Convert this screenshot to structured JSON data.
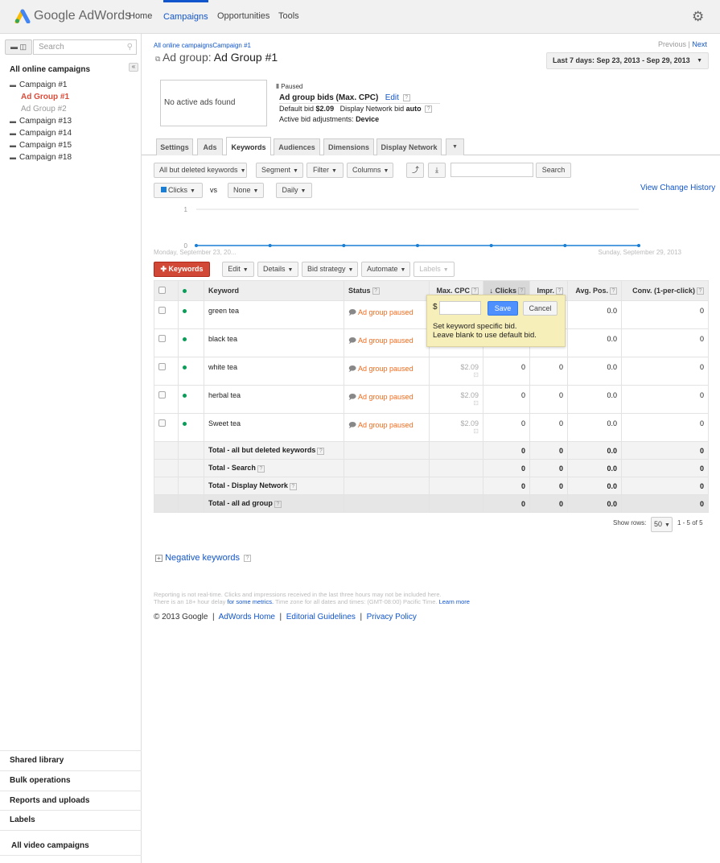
{
  "header": {
    "logo_google": "Google",
    "logo_product": "AdWords",
    "nav": [
      "Home",
      "Campaigns",
      "Opportunities",
      "Tools"
    ],
    "active_nav": "Campaigns"
  },
  "sidebar": {
    "search_placeholder": "Search",
    "title": "All online campaigns",
    "tree": [
      {
        "label": "Campaign #1",
        "level": 0
      },
      {
        "label": "Ad Group #1",
        "level": 1,
        "selected": true
      },
      {
        "label": "Ad Group #2",
        "level": 1
      },
      {
        "label": "Campaign #13",
        "level": 0
      },
      {
        "label": "Campaign #14",
        "level": 0
      },
      {
        "label": "Campaign #15",
        "level": 0
      },
      {
        "label": "Campaign #18",
        "level": 0
      }
    ],
    "footer": [
      "Shared library",
      "Bulk operations",
      "Reports and uploads",
      "Labels",
      "All video campaigns"
    ]
  },
  "breadcrumb": [
    "All online campaigns",
    "Campaign #1"
  ],
  "pager": {
    "previous": "Previous",
    "sep": "|",
    "next": "Next"
  },
  "title": {
    "prefix": "Ad group:",
    "name": "Ad Group #1"
  },
  "date_range": "Last 7 days: Sep 23, 2013 - Sep 29, 2013",
  "ads_box": "No active ads found",
  "adgroup": {
    "status": "Paused",
    "bids_title": "Ad group bids (Max. CPC)",
    "edit": "Edit",
    "default_bid_label": "Default bid",
    "default_bid": "$2.09",
    "display_bid_label": "Display Network bid",
    "display_bid": "auto",
    "adjust_label": "Active bid adjustments:",
    "adjust_value": "Device"
  },
  "tabs": [
    "Settings",
    "Ads",
    "Keywords",
    "Audiences",
    "Dimensions",
    "Display Network"
  ],
  "active_tab": "Keywords",
  "toolbar": {
    "filter": "All but deleted keywords",
    "segment": "Segment",
    "filter_btn": "Filter",
    "columns": "Columns",
    "search": "Search",
    "search_value": ""
  },
  "chart_controls": {
    "metric1": "Clicks",
    "vs": "vs",
    "metric2": "None",
    "period": "Daily",
    "history": "View Change History"
  },
  "chart_data": {
    "type": "line",
    "series": [
      {
        "name": "Clicks",
        "values": [
          0,
          0,
          0,
          0,
          0,
          0,
          0
        ]
      }
    ],
    "y_ticks": [
      "1",
      "0"
    ],
    "ylim": [
      0,
      1
    ],
    "x_start_label": "Monday, September 23, 20...",
    "x_end_label": "Sunday, September 29, 2013",
    "color": "#1a7fd4"
  },
  "actions": {
    "add": "Keywords",
    "edit": "Edit",
    "details": "Details",
    "bid_strategy": "Bid strategy",
    "automate": "Automate",
    "labels": "Labels"
  },
  "table": {
    "headers": [
      "Keyword",
      "Status",
      "Max. CPC",
      "Clicks",
      "Impr.",
      "Avg. Pos.",
      "Conv. (1-per-click)"
    ],
    "rows": [
      {
        "keyword": "green tea",
        "status": "Ad group paused",
        "cpc": "",
        "clicks": "",
        "impr": "",
        "pos": "0.0",
        "conv": "0"
      },
      {
        "keyword": "black tea",
        "status": "Ad group paused",
        "cpc": "",
        "clicks": "",
        "impr": "",
        "pos": "0.0",
        "conv": "0"
      },
      {
        "keyword": "white tea",
        "status": "Ad group paused",
        "cpc": "$2.09",
        "clicks": "0",
        "impr": "0",
        "pos": "0.0",
        "conv": "0"
      },
      {
        "keyword": "herbal tea",
        "status": "Ad group paused",
        "cpc": "$2.09",
        "clicks": "0",
        "impr": "0",
        "pos": "0.0",
        "conv": "0"
      },
      {
        "keyword": "Sweet tea",
        "status": "Ad group paused",
        "cpc": "$2.09",
        "clicks": "0",
        "impr": "0",
        "pos": "0.0",
        "conv": "0"
      }
    ],
    "totals": [
      {
        "label": "Total - all but deleted keywords",
        "clicks": "0",
        "impr": "0",
        "pos": "0.0",
        "conv": "0"
      },
      {
        "label": "Total - Search",
        "clicks": "0",
        "impr": "0",
        "pos": "0.0",
        "conv": "0"
      },
      {
        "label": "Total - Display Network",
        "clicks": "0",
        "impr": "0",
        "pos": "0.0",
        "conv": "0"
      },
      {
        "label": "Total - all ad group",
        "clicks": "0",
        "impr": "0",
        "pos": "0.0",
        "conv": "0"
      }
    ]
  },
  "bid_popup": {
    "currency": "$",
    "value": "",
    "save": "Save",
    "cancel": "Cancel",
    "line1": "Set keyword specific bid.",
    "line2": "Leave blank to use default bid."
  },
  "pagination": {
    "show_rows": "Show rows:",
    "rows": "50",
    "range": "1 - 5 of 5"
  },
  "negative_keywords": "Negative keywords",
  "footer": {
    "note1": "Reporting is not real-time. Clicks and impressions received in the last three hours may not be included here.",
    "note2a": "There is an 18+ hour delay",
    "note2link": "for some metrics.",
    "note2b": "Time zone for all dates and times: (GMT-08:00) Pacific Time.",
    "learn": "Learn more",
    "copyright": "© 2013 Google",
    "links": [
      "AdWords Home",
      "Editorial Guidelines",
      "Privacy Policy"
    ]
  }
}
